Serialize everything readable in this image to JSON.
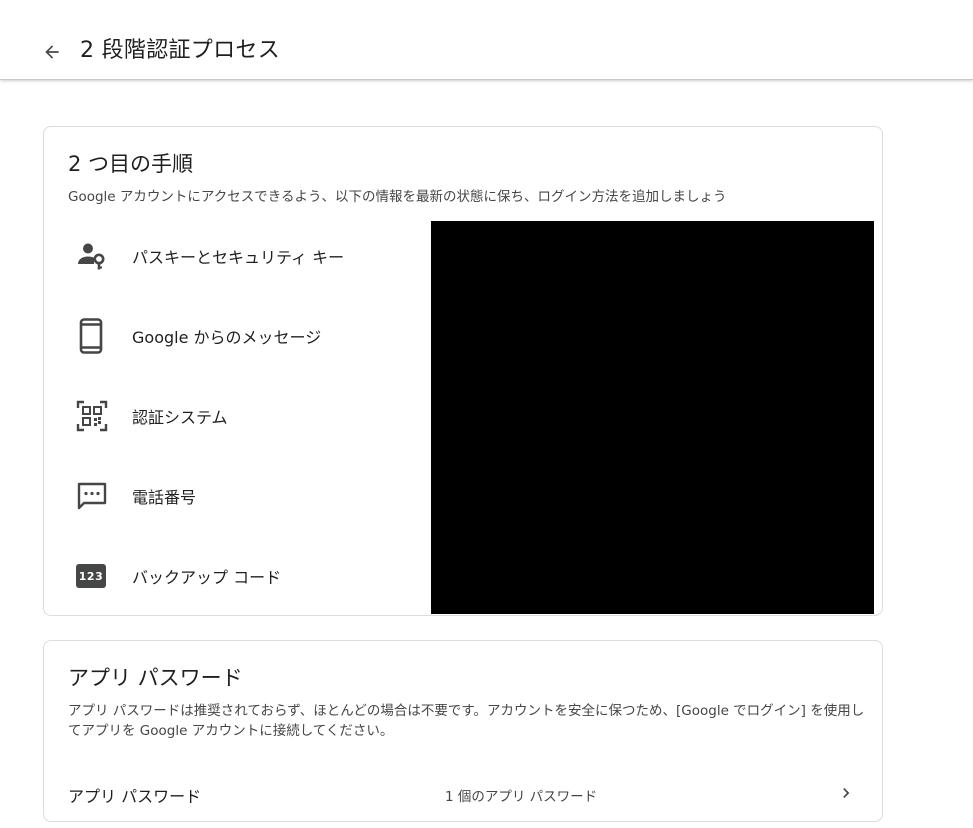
{
  "header": {
    "title": "2 段階認証プロセス"
  },
  "second_step": {
    "title": "2 つ目の手順",
    "description": "Google アカウントにアクセスできるよう、以下の情報を最新の状態に保ち、ログイン方法を追加しましょう",
    "methods": [
      {
        "label": "パスキーとセキュリティ キー",
        "icon": "person-key-icon"
      },
      {
        "label": "Google からのメッセージ",
        "icon": "phone-icon"
      },
      {
        "label": "認証システム",
        "icon": "qr-code-icon"
      },
      {
        "label": "電話番号",
        "icon": "sms-icon"
      },
      {
        "label": "バックアップ コード",
        "icon": "backup-codes-icon",
        "badge": "123"
      }
    ]
  },
  "app_passwords": {
    "title": "アプリ パスワード",
    "description": "アプリ パスワードは推奨されておらず、ほとんどの場合は不要です。アカウントを安全に保つため、[Google でログイン] を使用してアプリを Google アカウントに接続してください。",
    "row_label": "アプリ パスワード",
    "row_value": "1 個のアプリ パスワード"
  },
  "colors": {
    "text_primary": "#1f1f1f",
    "text_secondary": "#444746",
    "icon": "#444746",
    "border": "#dadce0"
  }
}
